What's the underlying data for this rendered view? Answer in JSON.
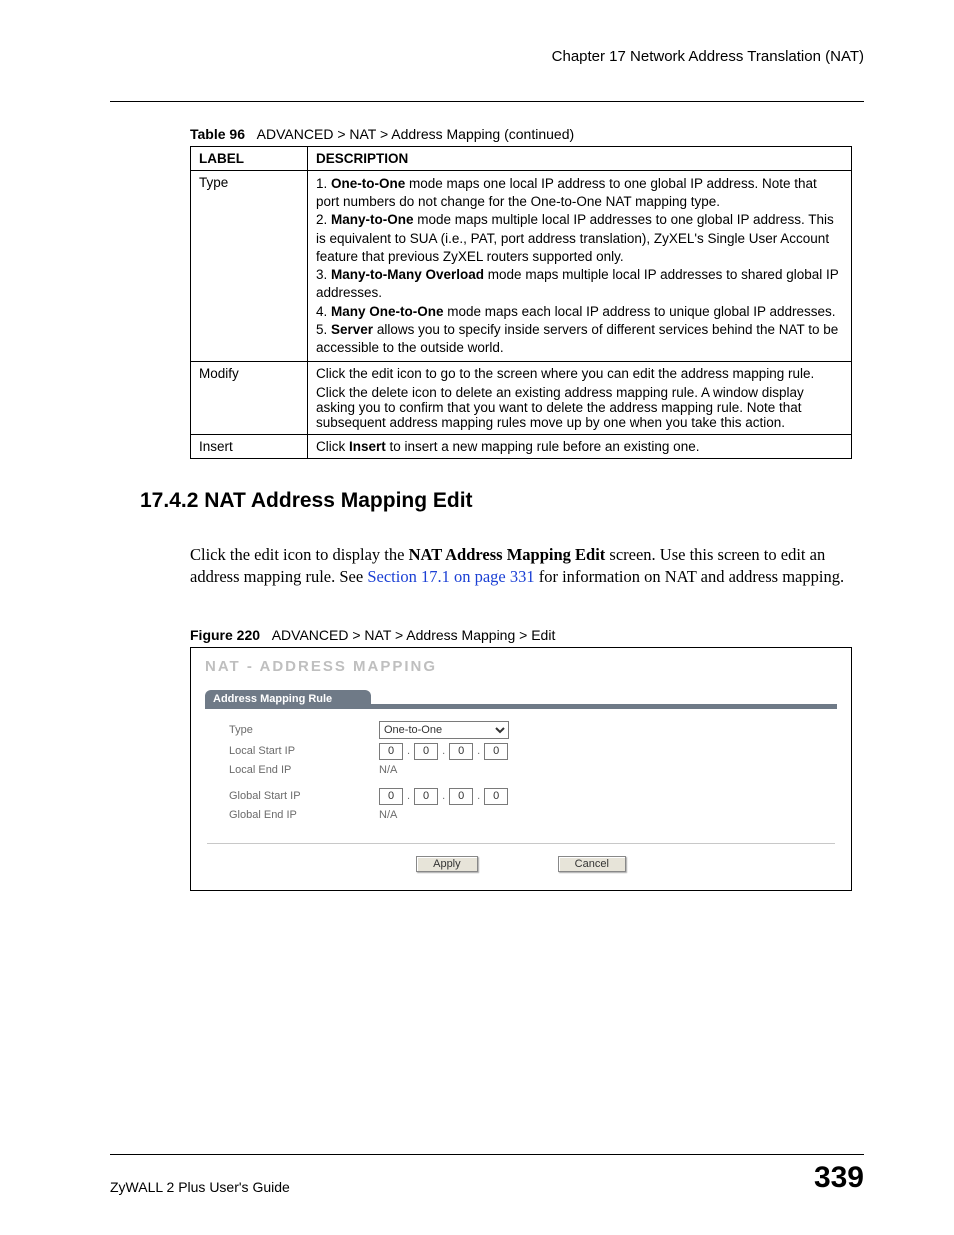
{
  "chapter_header": "Chapter 17 Network Address Translation (NAT)",
  "table96": {
    "caption_label": "Table 96",
    "caption_text": "ADVANCED > NAT > Address Mapping (continued)",
    "header_label": "LABEL",
    "header_desc": "DESCRIPTION",
    "rows": {
      "type": {
        "label": "Type",
        "l1_pre": "1. ",
        "l1_bold": "One-to-One",
        "l1_post": " mode maps one local IP address to one global IP address. Note that port numbers do not change for the One-to-One NAT mapping type.",
        "l2_pre": "2. ",
        "l2_bold": "Many-to-One",
        "l2_post": " mode maps multiple local IP addresses to one global IP address. This is equivalent to SUA (i.e., PAT, port address translation), ZyXEL's Single User Account feature that previous ZyXEL routers supported only.",
        "l3_pre": "3. ",
        "l3_bold": "Many-to-Many Overload",
        "l3_post": " mode maps multiple local IP addresses to shared global IP addresses.",
        "l4_pre": "4. ",
        "l4_bold": "Many One-to-One",
        "l4_post": " mode maps each local IP address to unique global IP addresses.",
        "l5_pre": "5. ",
        "l5_bold": "Server",
        "l5_post": " allows you to specify inside servers of different services behind the NAT to be accessible to the outside world."
      },
      "modify": {
        "label": "Modify",
        "p1": "Click the edit icon to go to the screen where you can edit the address mapping rule.",
        "p2": "Click the delete icon to delete an existing address mapping rule. A window display asking you to confirm that you want to delete the address mapping rule. Note that subsequent address mapping rules move up by one when you take this action."
      },
      "insert": {
        "label": "Insert",
        "pre": "Click ",
        "bold": "Insert",
        "post": " to insert a new mapping rule before an existing one."
      }
    }
  },
  "section_heading": "17.4.2  NAT Address Mapping Edit",
  "body_para": {
    "pre": "Click the edit icon to display the ",
    "bold": "NAT Address Mapping Edit",
    "mid": " screen. Use this screen to edit an address mapping rule. See ",
    "xref": "Section 17.1 on page 331",
    "post": " for information on NAT and address mapping."
  },
  "figure220": {
    "caption_label": "Figure 220",
    "caption_text": "ADVANCED > NAT > Address Mapping > Edit",
    "title": "NAT - ADDRESS MAPPING",
    "panel_header": "Address Mapping Rule",
    "labels": {
      "type": "Type",
      "local_start": "Local Start IP",
      "local_end": "Local End IP",
      "global_start": "Global Start IP",
      "global_end": "Global End IP"
    },
    "values": {
      "type_selected": "One-to-One",
      "ip_zero": "0",
      "na": "N/A"
    },
    "buttons": {
      "apply": "Apply",
      "cancel": "Cancel"
    }
  },
  "footer": {
    "guide": "ZyWALL 2 Plus User's Guide",
    "page": "339"
  }
}
